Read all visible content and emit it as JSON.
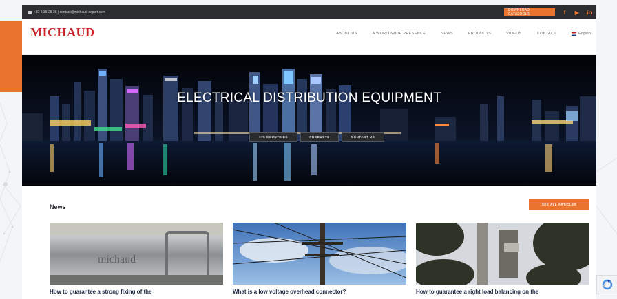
{
  "topbar": {
    "contact_text": "+33 5 35 25 36 | contact@michaud-export.com",
    "cta_label": "DOWNLOAD CATALOGUE",
    "social": [
      "f",
      "▶",
      "in"
    ]
  },
  "header": {
    "logo": "MICHAUD",
    "nav": [
      "ABOUT US",
      "A WORLDWIDE PRESENCE",
      "NEWS",
      "PRODUCTS",
      "VIDEOS",
      "CONTACT"
    ],
    "language": "English"
  },
  "hero": {
    "title": "ELECTRICAL DISTRIBUTION EQUIPMENT",
    "buttons": [
      "175 COUNTRIES",
      "PRODUCTS",
      "CONTACT US"
    ]
  },
  "news": {
    "heading": "News",
    "see_all": "SEE ALL ARTICLES",
    "cards": [
      {
        "title": "How to guarantee a strong fixing of the",
        "image_text": "michaud"
      },
      {
        "title": "What is a low voltage overhead connector?"
      },
      {
        "title": "How to guarantee a right load balancing on the"
      }
    ]
  },
  "colors": {
    "accent": "#e8742f",
    "brand": "#c8252b",
    "topbar": "#2b2d31"
  }
}
